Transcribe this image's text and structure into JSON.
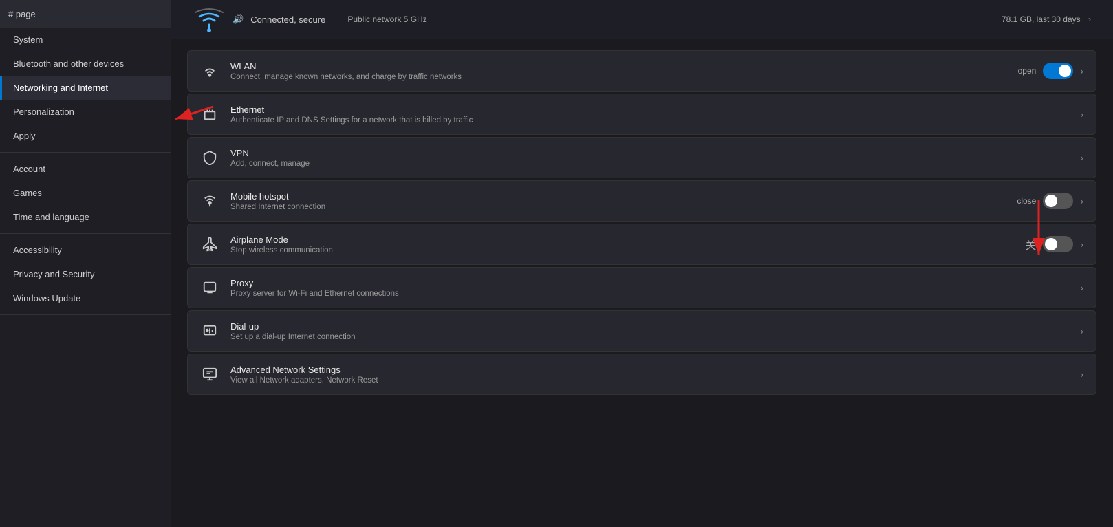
{
  "sidebar": {
    "header": "# page",
    "items": [
      {
        "id": "system",
        "label": "System",
        "active": false,
        "level": 0
      },
      {
        "id": "bluetooth",
        "label": "Bluetooth and other devices",
        "active": false,
        "level": 0
      },
      {
        "id": "networking",
        "label": "Networking and Internet",
        "active": true,
        "level": 0
      },
      {
        "id": "personalization",
        "label": "Personalization",
        "active": false,
        "level": 0
      },
      {
        "id": "apps",
        "label": "Apply",
        "active": false,
        "level": 0
      },
      {
        "id": "account",
        "label": "Account",
        "active": false,
        "level": 0
      },
      {
        "id": "games",
        "label": "Games",
        "active": false,
        "level": 0
      },
      {
        "id": "time",
        "label": "Time and language",
        "active": false,
        "level": 0
      },
      {
        "id": "accessibility",
        "label": "Accessibility",
        "active": false,
        "level": 0
      },
      {
        "id": "privacy",
        "label": "Privacy and Security",
        "active": false,
        "level": 0
      },
      {
        "id": "windows",
        "label": "Windows Update",
        "active": false,
        "level": 0
      }
    ]
  },
  "wifi_status": {
    "connected_text": "Connected, secure",
    "network_type": "Public network 5 GHz",
    "data_usage": "78.1 GB, last 30 days"
  },
  "settings_items": [
    {
      "id": "wlan",
      "icon": "wifi",
      "title": "WLAN",
      "subtitle": "Connect, manage known networks, and charge by traffic networks",
      "has_toggle": true,
      "toggle_state": "on",
      "toggle_label": "open",
      "has_chevron": true
    },
    {
      "id": "ethernet",
      "icon": "ethernet",
      "title": "Ethernet",
      "subtitle": "Authenticate IP and DNS Settings for a network that is billed by traffic",
      "has_toggle": false,
      "toggle_state": null,
      "toggle_label": "",
      "has_chevron": true
    },
    {
      "id": "vpn",
      "icon": "vpn",
      "title": "VPN",
      "subtitle": "Add, connect, manage",
      "has_toggle": false,
      "toggle_state": null,
      "toggle_label": "",
      "has_chevron": true
    },
    {
      "id": "hotspot",
      "icon": "hotspot",
      "title": "Mobile hotspot",
      "subtitle": "Shared Internet connection",
      "has_toggle": true,
      "toggle_state": "off",
      "toggle_label": "close",
      "has_chevron": true
    },
    {
      "id": "airplane",
      "icon": "airplane",
      "title": "Airplane Mode",
      "subtitle": "Stop wireless communication",
      "has_toggle": true,
      "toggle_state": "off",
      "toggle_label": "",
      "has_chevron": true,
      "has_kanji": true,
      "kanji": "关"
    },
    {
      "id": "proxy",
      "icon": "proxy",
      "title": "Proxy",
      "subtitle": "Proxy server for Wi-Fi and Ethernet connections",
      "has_toggle": false,
      "toggle_state": null,
      "toggle_label": "",
      "has_chevron": true
    },
    {
      "id": "dialup",
      "icon": "dialup",
      "title": "Dial-up",
      "subtitle": "Set up a dial-up Internet connection",
      "has_toggle": false,
      "toggle_state": null,
      "toggle_label": "",
      "has_chevron": true
    },
    {
      "id": "advanced",
      "icon": "advanced",
      "title": "Advanced Network Settings",
      "subtitle": "View all Network adapters, Network Reset",
      "has_toggle": false,
      "toggle_state": null,
      "toggle_label": "",
      "has_chevron": true
    }
  ],
  "icons": {
    "wifi": "📶",
    "ethernet": "🖧",
    "vpn": "🛡",
    "hotspot": "📡",
    "airplane": "✈",
    "proxy": "🖥",
    "dialup": "☎",
    "advanced": "🖥"
  }
}
